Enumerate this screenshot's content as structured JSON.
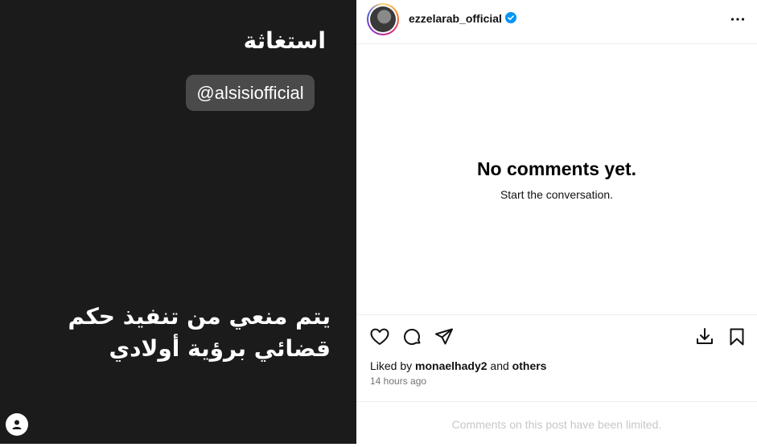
{
  "media": {
    "title_ar": "استغاثة",
    "mention": "@alsisiofficial",
    "body_ar_line1": "يتم منعي من تنفيذ حكم",
    "body_ar_line2": "قضائي برؤية أولادي"
  },
  "header": {
    "username": "ezzelarab_official",
    "verified_color": "#0095f6"
  },
  "comments": {
    "empty_title": "No comments yet.",
    "empty_subtitle": "Start the conversation."
  },
  "actions": {
    "icons": [
      "heart-icon",
      "comment-icon",
      "share-icon",
      "download-icon",
      "bookmark-icon"
    ]
  },
  "likes": {
    "prefix": "Liked by",
    "user": "monaelhady2",
    "conjunction": "and",
    "others": "others"
  },
  "timestamp": "14 hours ago",
  "footer": {
    "limited_text": "Comments on this post have been limited."
  }
}
